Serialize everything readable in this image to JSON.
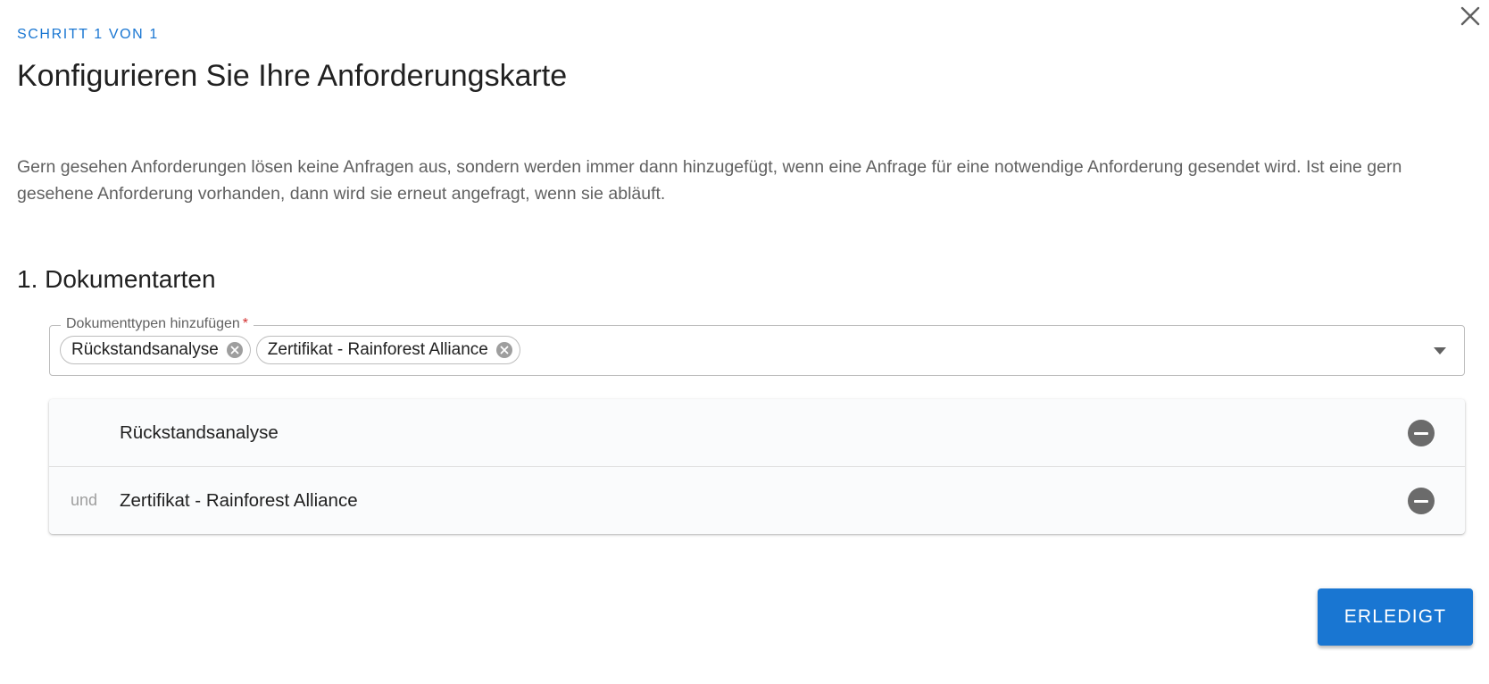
{
  "dialog": {
    "step_label": "SCHRITT 1 VON 1",
    "title": "Konfigurieren Sie Ihre Anforderungskarte",
    "description": "Gern gesehen Anforderungen lösen keine Anfragen aus, sondern werden immer dann hinzugefügt, wenn eine Anfrage für eine notwendige Anforderung gesendet wird. Ist eine gern gesehene Anforderung vorhanden, dann wird sie erneut angefragt, wenn sie abläuft.",
    "close_icon": "close-icon"
  },
  "section": {
    "title": "1. Dokumentarten"
  },
  "document_types_field": {
    "label": "Dokumenttypen hinzufügen",
    "required_marker": "*",
    "chips": [
      {
        "label": "Rückstandsanalyse",
        "delete_icon": "cancel-circle-icon"
      },
      {
        "label": "Zertifikat - Rainforest Alliance",
        "delete_icon": "cancel-circle-icon"
      }
    ],
    "dropdown_icon": "arrow-drop-down-icon"
  },
  "requirements": [
    {
      "conjunction": "",
      "label": "Rückstandsanalyse",
      "remove_icon": "remove-circle-icon"
    },
    {
      "conjunction": "und",
      "label": "Zertifikat - Rainforest Alliance",
      "remove_icon": "remove-circle-icon"
    }
  ],
  "actions": {
    "done_label": "ERLEDIGT"
  },
  "colors": {
    "primary": "#1976d2",
    "required": "#d32f2f",
    "text": "#212121",
    "secondary_text": "#616161"
  }
}
